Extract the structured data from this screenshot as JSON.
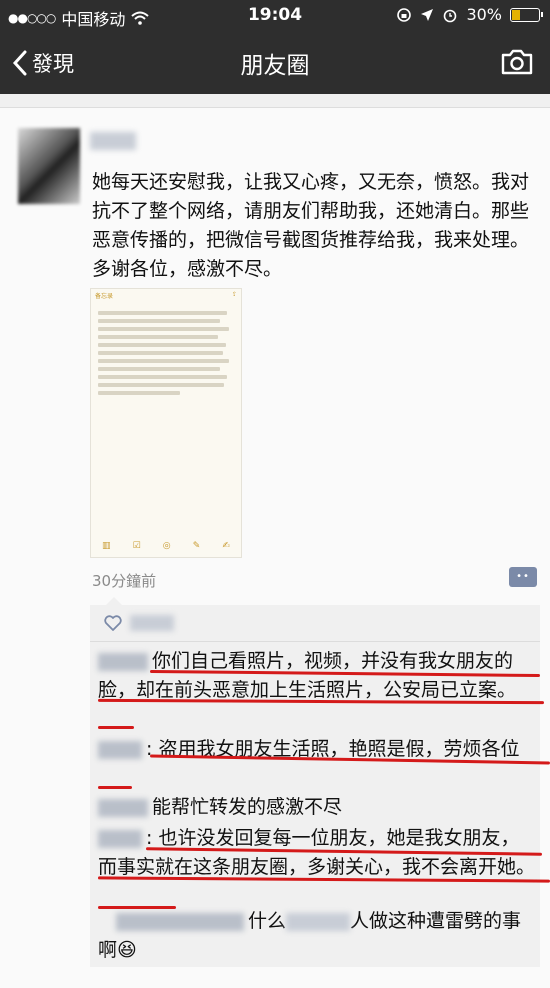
{
  "status_bar": {
    "carrier": "中国移动",
    "time": "19:04",
    "battery": "30%",
    "battery_level": 0.3
  },
  "nav": {
    "back_label": "發現",
    "title": "朋友圈",
    "camera_icon": "camera-icon"
  },
  "post": {
    "text": "她每天还安慰我，让我又心疼，又无奈，愤怒。我对抗不了整个网络，请朋友们帮助我，还她清白。那些恶意传播的，把微信号截图货推荐给我，我来处理。多谢各位，感激不尽。",
    "screenshot_back": "备忘录",
    "time_ago": "30分鐘前"
  },
  "comments": [
    {
      "text": "你们自己看照片，视频，并没有我女朋友的脸，却在前头恶意加上生活照片，公安局已立案。"
    },
    {
      "text": ": 盗用我女朋友生活照，艳照是假，劳烦各位"
    },
    {
      "text": "能帮忙转发的感激不尽"
    },
    {
      "text": ": 也许没发回复每一位朋友，她是我女朋友，而事实就在这条朋友圈，多谢关心，我不会离开她。"
    },
    {
      "text_a": "什么",
      "text_b": "人做这种遭雷劈的事啊"
    }
  ],
  "colors": {
    "bar": "#2e2e2e",
    "underline": "#d41a1a",
    "time_gray": "#8a8a8a"
  }
}
